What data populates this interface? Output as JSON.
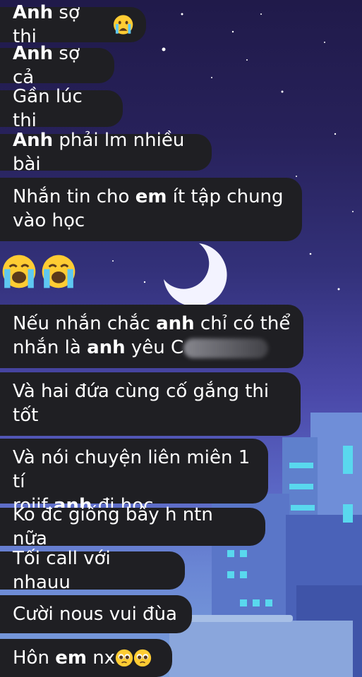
{
  "messages": [
    {
      "pre": "",
      "bold": "Anh",
      "post": " sợ thi",
      "emoji": "crying-face",
      "emoji_count": 1
    },
    {
      "pre": "",
      "bold": "Anh",
      "post": " sợ cả"
    },
    {
      "text": "Gần lúc thi"
    },
    {
      "pre": "",
      "bold": "Anh",
      "post": " phải lm nhiều bài"
    },
    {
      "line1_pre": "Nhắn tin cho ",
      "line1_bold": "em",
      "line1_post": " ít tập chung",
      "line2": "vào học"
    },
    {
      "emoji": "loudly-crying-face",
      "emoji_count": 2
    },
    {
      "line1_pre": "Nếu nhắn chắc ",
      "line1_bold": "anh",
      "line1_post": " chỉ có thể",
      "line2_pre": "nhắn là ",
      "line2_bold": "anh",
      "line2_post": " yêu C"
    },
    {
      "line1": "Và hai đứa cùng cố gắng thi",
      "line2": "tốt"
    },
    {
      "line1": "Và nói chuyện liên miên 1 tí",
      "line2_pre": "roiif ",
      "line2_bold": "anh",
      "line2_post": " đi học"
    },
    {
      "text": "Ko đc giống bây h ntn nữa"
    },
    {
      "text": "Tối call với nhauu"
    },
    {
      "text": "Cười nous vui đùa"
    },
    {
      "pre": "Hôn ",
      "bold": "em",
      "post": " nx",
      "emoji": "pleading-face",
      "emoji_count": 2
    }
  ],
  "colors": {
    "bubble": "#1f1f23",
    "text": "#ffffff"
  }
}
